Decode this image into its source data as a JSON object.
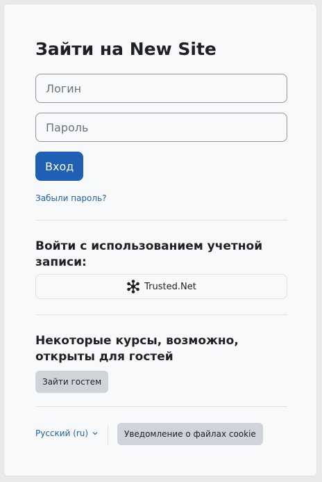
{
  "login": {
    "title": "Зайти на New Site",
    "username_placeholder": "Логин",
    "password_placeholder": "Пароль",
    "submit_label": "Вход",
    "forgot_password_link": "Забыли пароль?"
  },
  "sso": {
    "heading": "Войти с использованием учетной записи:",
    "provider_label": "Trusted.Net",
    "provider_icon": "network-star-icon"
  },
  "guest": {
    "heading": "Некоторые курсы, возможно, открыты для гостей",
    "button_label": "Зайти гостем"
  },
  "footer": {
    "language_label": "Русский (ru)",
    "cookie_button_label": "Уведомление о файлах cookie"
  },
  "colors": {
    "primary": "#1f5fb4",
    "secondary_button": "#ced4da",
    "card_background": "#f8f9fa",
    "text": "#1d2125"
  }
}
